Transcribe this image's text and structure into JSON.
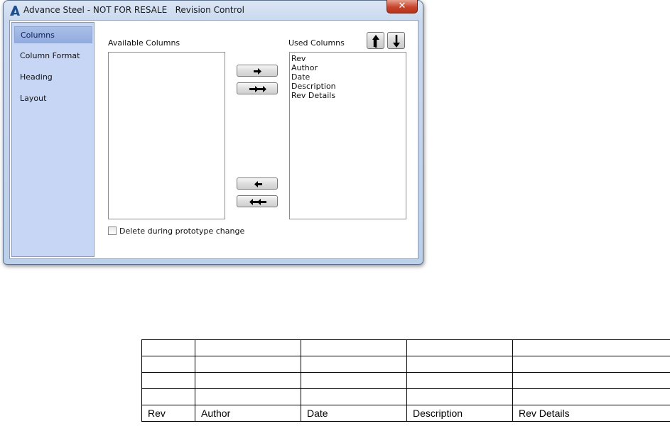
{
  "window": {
    "title": "Advance Steel - NOT FOR RESALE   Revision Control",
    "close_glyph": "✕"
  },
  "nav": {
    "items": [
      {
        "label": "Columns",
        "active": true
      },
      {
        "label": "Column Format"
      },
      {
        "label": "Heading"
      },
      {
        "label": "Layout"
      }
    ]
  },
  "columns_panel": {
    "available_label": "Available Columns",
    "used_label": "Used Columns",
    "available_items": [],
    "used_items": [
      "Rev",
      "Author",
      "Date",
      "Description",
      "Rev Details"
    ],
    "buttons": {
      "add_one": "arrow-right-icon",
      "add_all": "double-arrow-right-icon",
      "remove_one": "arrow-left-icon",
      "remove_all": "double-arrow-left-icon",
      "move_up": "arrow-up-icon",
      "move_down": "arrow-down-icon"
    },
    "delete_checkbox": {
      "label": "Delete during prototype change",
      "checked": false
    }
  },
  "drawing_table": {
    "empty_rows": 4,
    "headers": [
      "Rev",
      "Author",
      "Date",
      "Description",
      "Rev Details"
    ]
  },
  "colors": {
    "nav_bg": "#c7d6f4",
    "nav_active": "#9fb6e4",
    "close_button": "#c7452c",
    "window_frame": "#bcd0ea"
  }
}
